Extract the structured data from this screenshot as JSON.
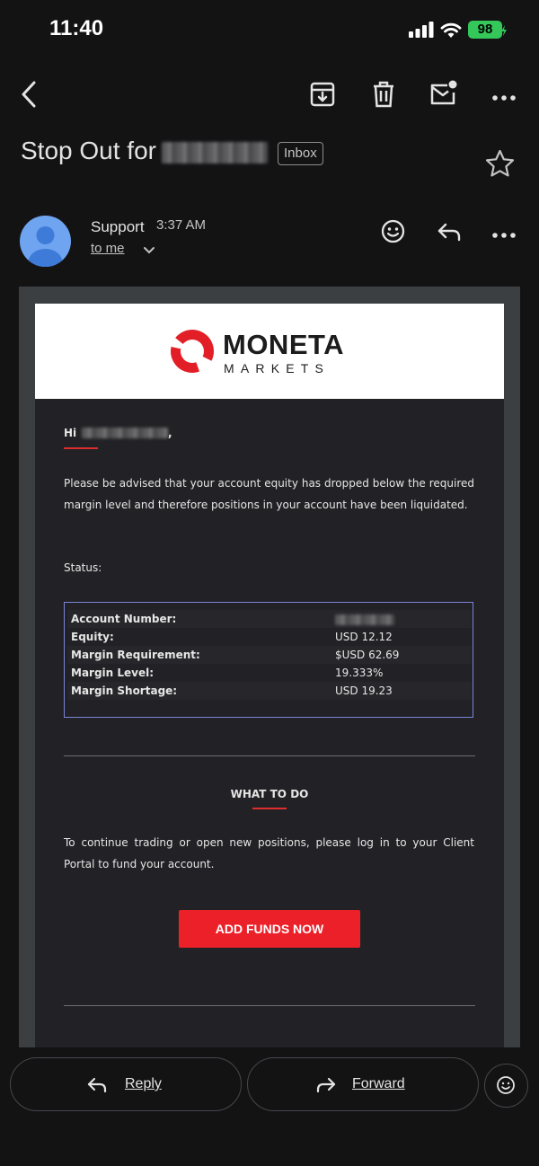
{
  "status_bar": {
    "time": "11:40",
    "battery": "98"
  },
  "header": {
    "subject_prefix": "Stop Out for",
    "label_chip": "Inbox"
  },
  "sender": {
    "name": "Support",
    "time": "3:37 AM",
    "recipient": "to me"
  },
  "email": {
    "brand_name": "MONETA",
    "brand_sub": "MARKETS",
    "greeting_prefix": "Hi",
    "greeting_suffix": ",",
    "body": "Please be advised that your account equity has dropped below the required margin level and therefore positions in your account have been liquidated.",
    "status_label": "Status:",
    "status_rows": [
      {
        "key": "Account Number:",
        "value": ""
      },
      {
        "key": "Equity:",
        "value": "USD 12.12"
      },
      {
        "key": "Margin Requirement:",
        "value": "$USD 62.69"
      },
      {
        "key": "Margin Level:",
        "value": "19.333%"
      },
      {
        "key": "Margin Shortage:",
        "value": "USD 19.23"
      }
    ],
    "section_title": "WHAT TO DO",
    "instruction": "To continue trading or open new positions, please log in to your Client Portal to fund your account.",
    "cta_label": "ADD FUNDS NOW"
  },
  "actions": {
    "reply": "Reply",
    "forward": "Forward"
  },
  "colors": {
    "accent_red": "#ec2028",
    "table_border": "#7b83d6",
    "avatar_blue": "#6ea4f0",
    "battery_green": "#34c759"
  }
}
